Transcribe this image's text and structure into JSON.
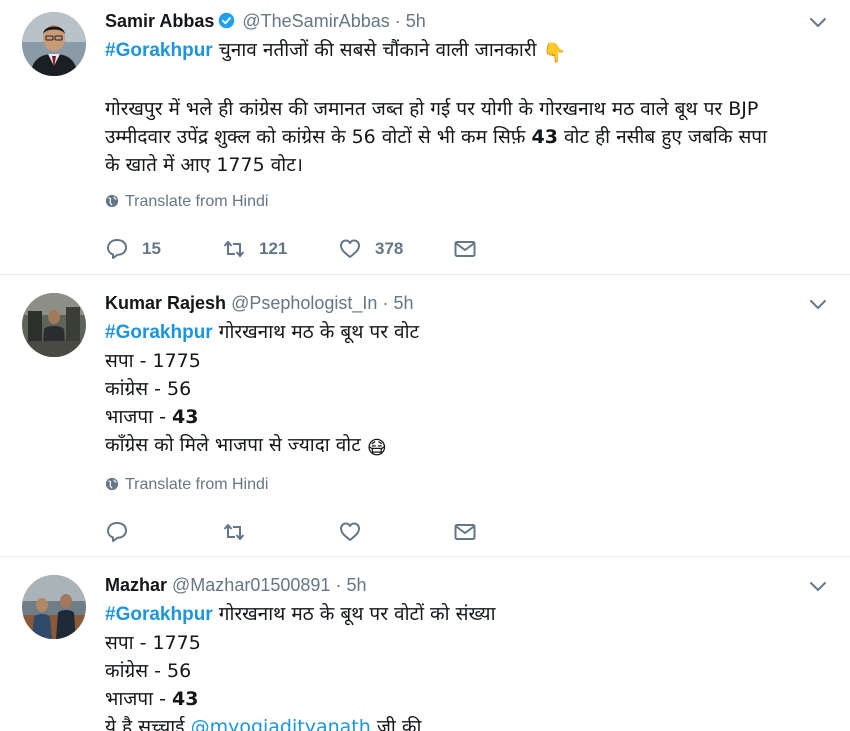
{
  "tweets": [
    {
      "name": "Samir Abbas",
      "handle": "@TheSamirAbbas",
      "sep": "·",
      "time": "5h",
      "verified": true,
      "hashtag": "#Gorakhpur",
      "first_line_rest": " चुनाव नतीजों की सबसे चौंकाने वाली जानकारी",
      "first_line_emoji": "👇",
      "para_lines": [
        "गोरखपुर में भले ही कांग्रेस की जमानत जब्त हो गई पर योगी के गोरखनाथ मठ वाले बूथ पर BJP",
        "उम्मीदवार उपेंद्र शुक्ल को कांग्रेस के 56 वोटों से भी कम सिर्फ़ ",
        "43",
        " वोट ही नसीब हुए जबकि सपा",
        "के खाते में आए 1775 वोट।"
      ],
      "translate": "Translate from Hindi",
      "replies": "15",
      "retweets": "121",
      "likes": "378"
    },
    {
      "name": "Kumar Rajesh",
      "handle": "@Psephologist_In",
      "sep": "·",
      "time": "5h",
      "hashtag": "#Gorakhpur",
      "first_line_rest": " गोरखनाथ मठ के बूथ पर वोट",
      "lines": [
        "सपा - 1775",
        "कांग्रेस - 56",
        "भाजपा - "
      ],
      "bold_value": "43",
      "last_line": "काँग्रेस को मिले भाजपा से ज्यादा वोट",
      "last_emoji": "😷",
      "translate": "Translate from Hindi"
    },
    {
      "name": "Mazhar",
      "handle": "@Mazhar01500891",
      "sep": "·",
      "time": "5h",
      "hashtag": "#Gorakhpur",
      "first_line_rest": " गोरखनाथ मठ के बूथ पर वोटों को संख्या",
      "lines": [
        "सपा - 1775",
        "कांग्रेस - 56",
        "भाजपा - "
      ],
      "bold_value": "43",
      "partial_line_prefix": "ये है सच्चाई ",
      "partial_mention": "@myogiadityanath",
      "partial_line_suffix": " जी की"
    }
  ],
  "colors": {
    "link": "#1b95e0",
    "muted": "#657786",
    "verified": "#1da1f2",
    "separator": "#e6ecf0"
  },
  "icons": [
    "reply-icon",
    "retweet-icon",
    "like-icon",
    "dm-icon",
    "globe-icon",
    "verified-badge-icon",
    "chevron-down-icon"
  ]
}
